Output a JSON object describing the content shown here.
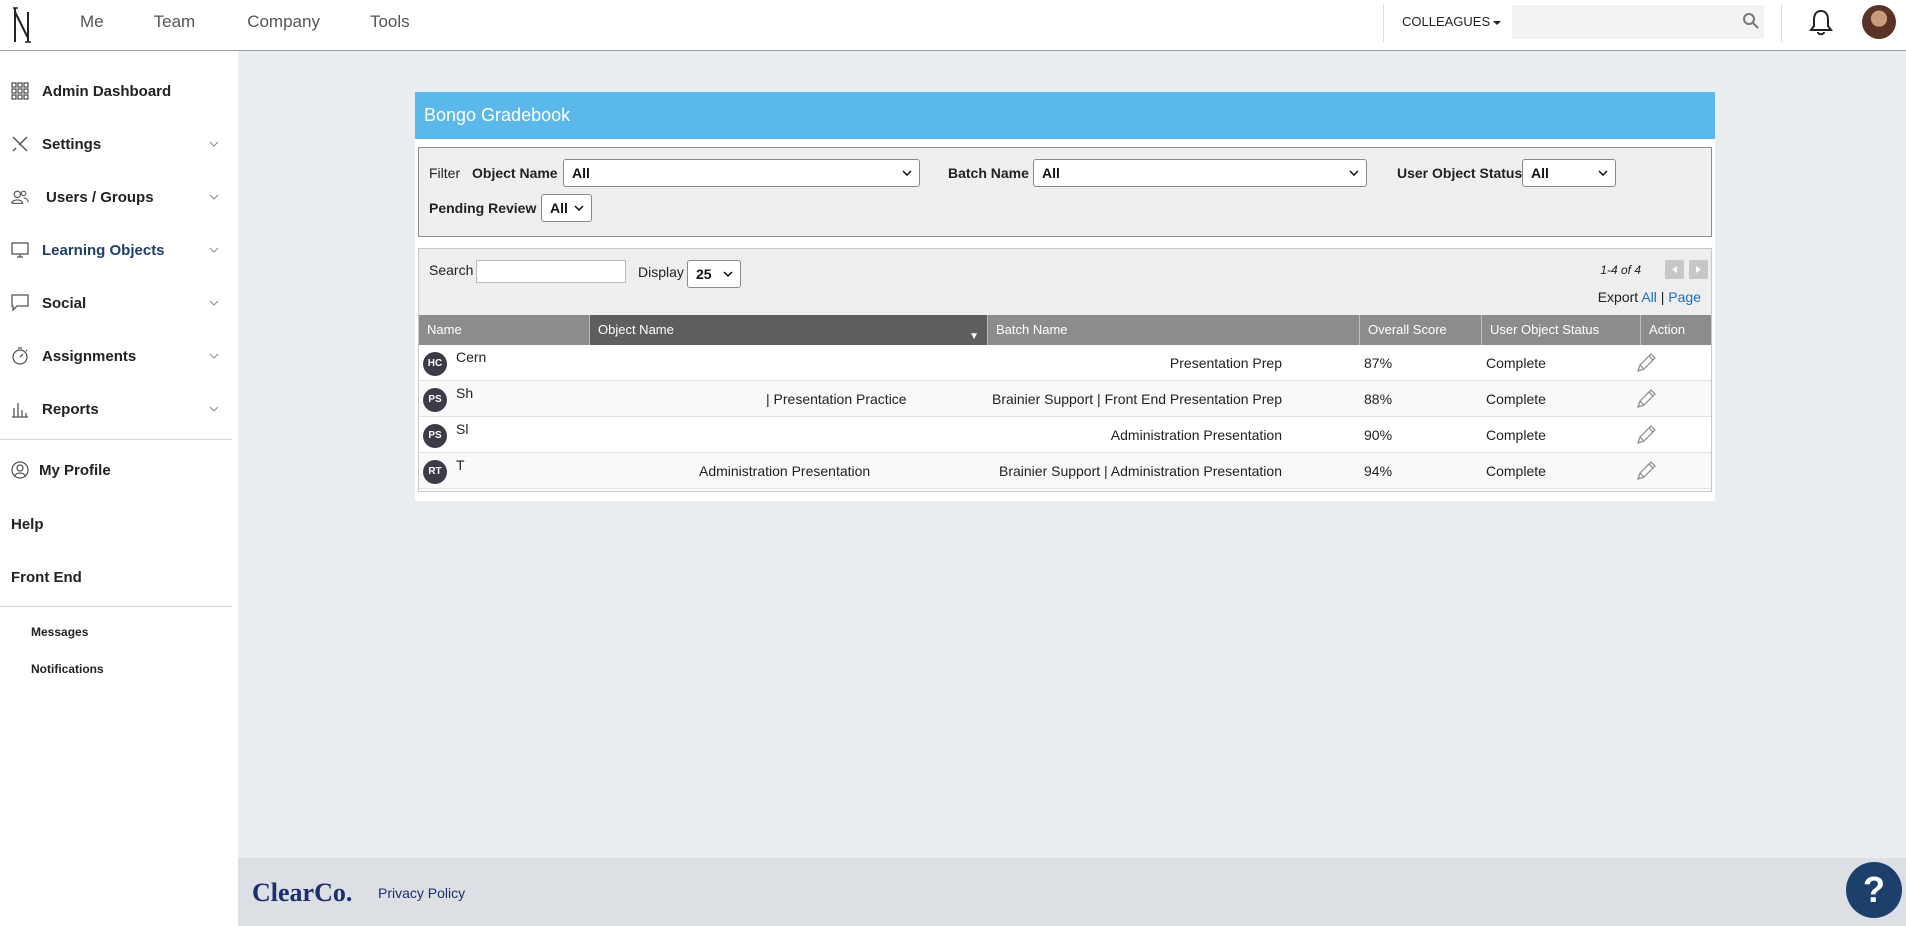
{
  "topnav": {
    "items": [
      "Me",
      "Team",
      "Company",
      "Tools"
    ]
  },
  "header": {
    "colleagues_label": "COLLEAGUES",
    "search_placeholder": ""
  },
  "sidebar": {
    "items": [
      {
        "label": "Admin Dashboard"
      },
      {
        "label": "Settings"
      },
      {
        "label": "Users / Groups"
      },
      {
        "label": "Learning Objects"
      },
      {
        "label": "Social"
      },
      {
        "label": "Assignments"
      },
      {
        "label": "Reports"
      }
    ],
    "my_profile": "My Profile",
    "help": "Help",
    "front_end": "Front End",
    "messages": "Messages",
    "notifications": "Notifications"
  },
  "panel": {
    "title": "Bongo Gradebook",
    "filter": {
      "label": "Filter",
      "object_name_label": "Object Name",
      "object_name_value": "All",
      "batch_name_label": "Batch Name",
      "batch_name_value": "All",
      "user_object_status_label": "User Object Status",
      "user_object_status_value": "All",
      "pending_review_label": "Pending Review",
      "pending_review_value": "All"
    },
    "grid": {
      "search_label": "Search",
      "display_label": "Display",
      "display_value": "25",
      "pager_text": "1-4 of 4",
      "export_label": "Export",
      "export_all": "All",
      "export_sep": "|",
      "export_page": "Page",
      "columns": [
        "Name",
        "Object Name",
        "Batch Name",
        "Overall Score",
        "User Object Status",
        "Action"
      ],
      "rows": [
        {
          "initials": "HC",
          "name": "Cern",
          "object_name": "",
          "batch_name": "Presentation Prep",
          "score": "87%",
          "status": "Complete"
        },
        {
          "initials": "PS",
          "name": "Sh",
          "object_name": "| Presentation Practice",
          "batch_name": "Brainier Support | Front End Presentation Prep",
          "score": "88%",
          "status": "Complete"
        },
        {
          "initials": "PS",
          "name": "Sl",
          "object_name": "",
          "batch_name": "Administration Presentation",
          "score": "90%",
          "status": "Complete"
        },
        {
          "initials": "RT",
          "name": "T",
          "object_name": "Administration Presentation",
          "batch_name": "Brainier Support | Administration Presentation",
          "score": "94%",
          "status": "Complete"
        }
      ]
    }
  },
  "footer": {
    "brand": "ClearCo.",
    "privacy": "Privacy Policy"
  },
  "help_button": "?",
  "colors": {
    "header_blue": "#5ab9ea",
    "brand_navy": "#1c2e6e",
    "link_blue": "#1a6fc1"
  }
}
